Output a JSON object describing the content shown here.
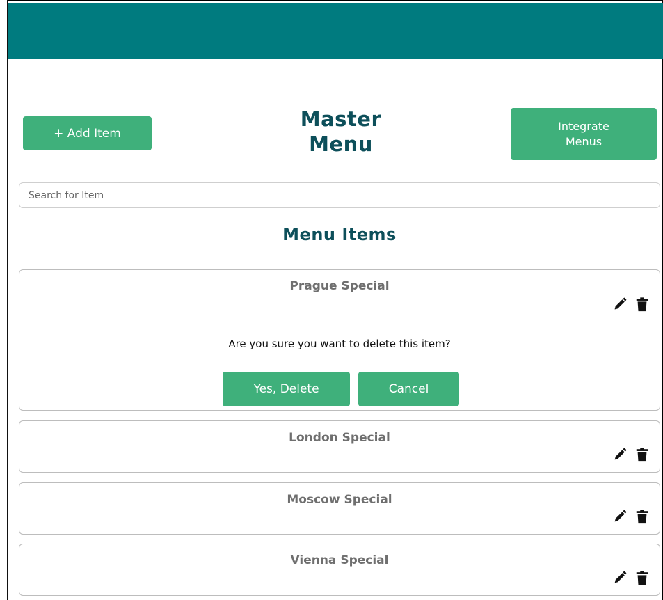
{
  "header": {
    "bar_color": "#007b7f"
  },
  "toolbar": {
    "add_item_label": "+ Add Item",
    "integrate_label": "Integrate\nMenus",
    "title": "Master\nMenu"
  },
  "search": {
    "placeholder": "Search for Item",
    "value": ""
  },
  "menu": {
    "section_title": "Menu Items",
    "items": [
      {
        "name": "Prague Special",
        "confirm_text": "Are you sure you want to delete this item?",
        "confirm_yes": "Yes, Delete",
        "confirm_cancel": "Cancel"
      },
      {
        "name": "London Special"
      },
      {
        "name": "Moscow Special"
      },
      {
        "name": "Vienna Special"
      }
    ]
  },
  "icons": {
    "edit": "pencil-icon",
    "delete": "trash-icon"
  },
  "colors": {
    "accent": "#3fb07b",
    "title": "#0d4f5a",
    "item_title": "#6f6f6f"
  }
}
